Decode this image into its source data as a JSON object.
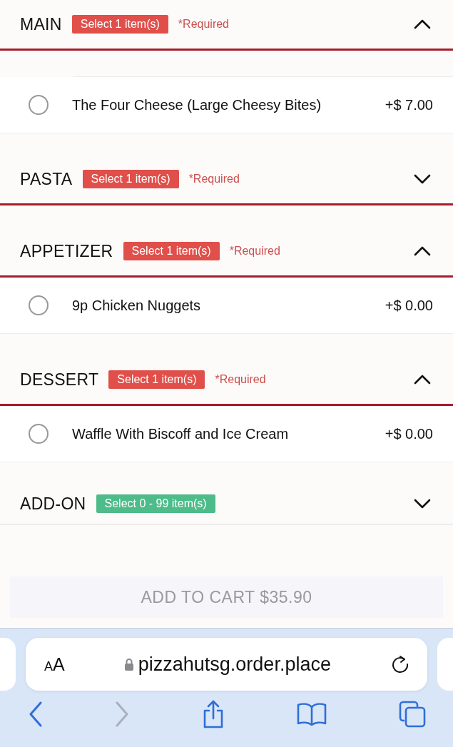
{
  "sections": [
    {
      "title": "MAIN",
      "badge": "Select 1 item(s)",
      "color": "#e04f4a",
      "required": "*Required",
      "expanded": true,
      "items": [
        {
          "name": "The Four Cheese (Large Cheesy Bites)",
          "price": "+$ 7.00",
          "selected": false
        }
      ]
    },
    {
      "title": "PASTA",
      "badge": "Select 1 item(s)",
      "color": "#e04f4a",
      "required": "*Required",
      "expanded": false
    },
    {
      "title": "APPETIZER",
      "badge": "Select 1 item(s)",
      "color": "#e04f4a",
      "required": "*Required",
      "expanded": true,
      "items": [
        {
          "name": "9p Chicken Nuggets",
          "price": "+$ 0.00",
          "selected": false
        }
      ]
    },
    {
      "title": "DESSERT",
      "badge": "Select 1 item(s)",
      "color": "#e04f4a",
      "required": "*Required",
      "expanded": true,
      "items": [
        {
          "name": "Waffle With Biscoff and Ice Cream",
          "price": "+$ 0.00",
          "selected": false
        }
      ]
    },
    {
      "title": "ADD-ON",
      "badge": "Select 0 - 99 item(s)",
      "color": "#4dbb8a",
      "expanded": false
    }
  ],
  "cart_button": {
    "label": "ADD TO CART $35.90",
    "disabled": true
  },
  "browser": {
    "text_size": "AA",
    "url": "pizzahutsg.order.place",
    "back_enabled": true,
    "forward_enabled": false
  }
}
